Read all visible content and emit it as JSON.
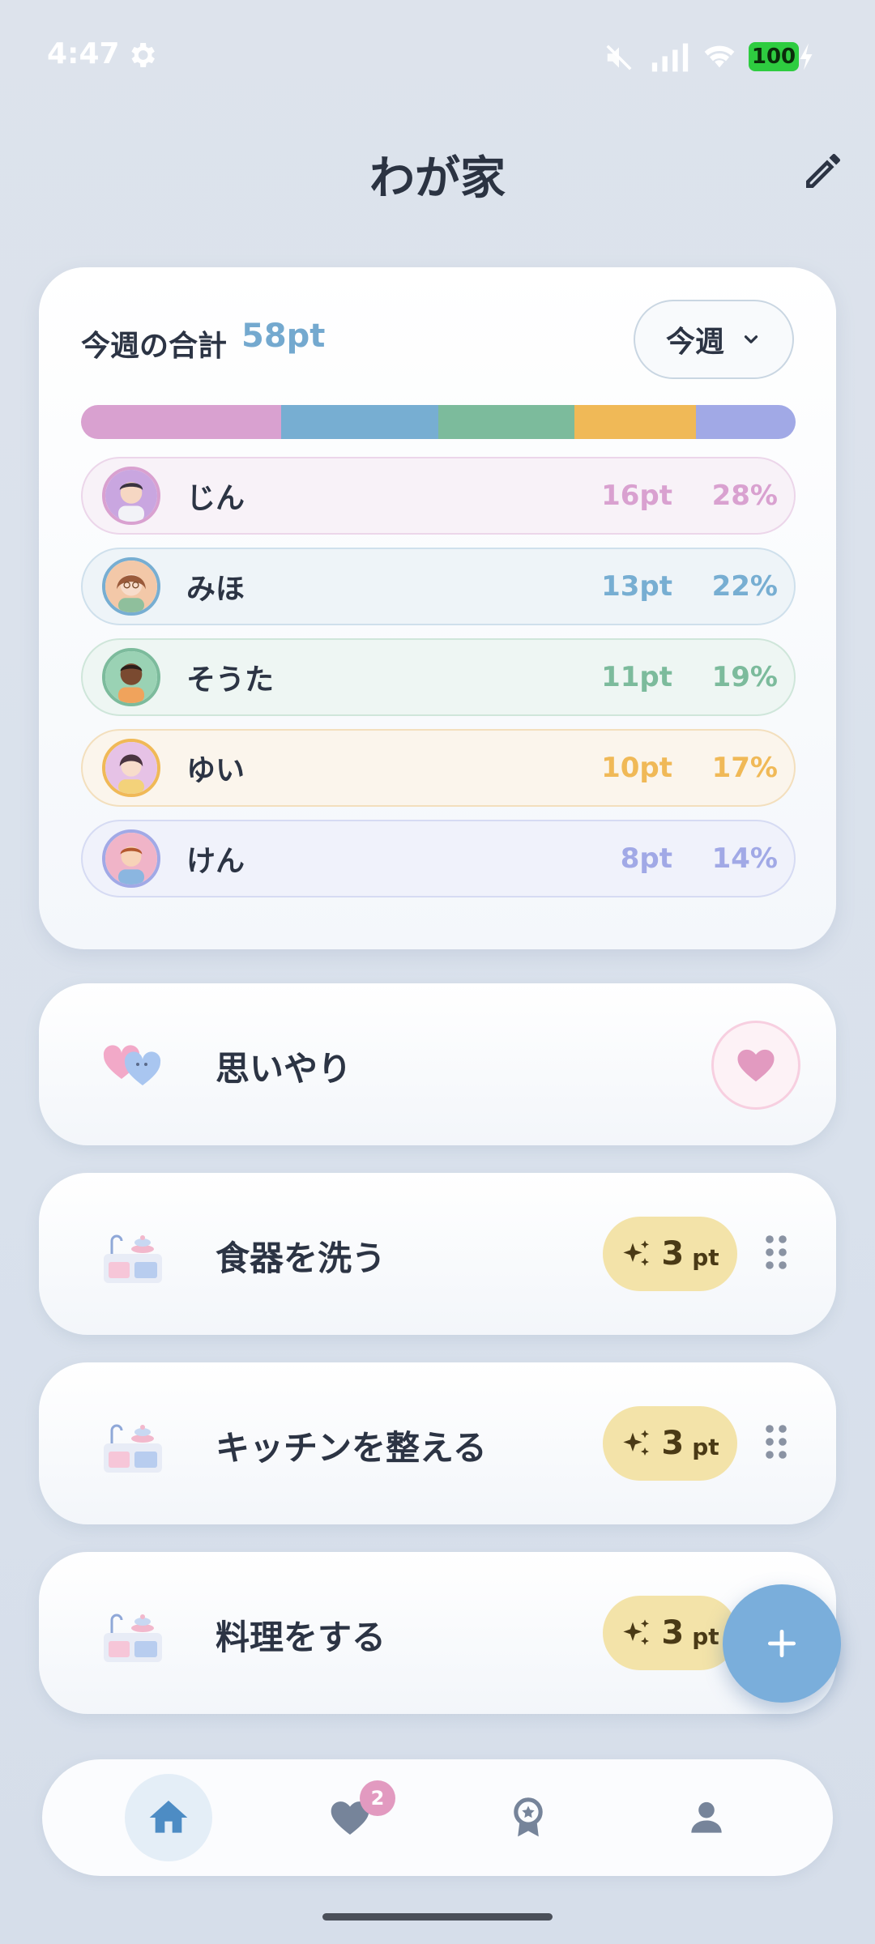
{
  "status_bar": {
    "time": "4:47",
    "battery": "100",
    "icons": [
      "gear-icon",
      "mute-icon",
      "signal-icon",
      "wifi-icon",
      "battery-icon",
      "charging-bolt-icon"
    ]
  },
  "header": {
    "title": "わが家",
    "edit_icon": "pencil-icon"
  },
  "summary": {
    "title": "今週の合計",
    "total": "58pt",
    "period_selected": "今週",
    "members": [
      {
        "name": "じん",
        "points": "16pt",
        "percent": "28%",
        "share": 0.28,
        "color": "#d9a1d0",
        "bg": "#f8f2f8",
        "border": "#ecd6ea"
      },
      {
        "name": "みほ",
        "points": "13pt",
        "percent": "22%",
        "share": 0.22,
        "color": "#77aed2",
        "bg": "#eef4f8",
        "border": "#cfe0ec"
      },
      {
        "name": "そうた",
        "points": "11pt",
        "percent": "19%",
        "share": 0.19,
        "color": "#7cbb9c",
        "bg": "#eef6f3",
        "border": "#cfe6da"
      },
      {
        "name": "ゆい",
        "points": "10pt",
        "percent": "17%",
        "share": 0.17,
        "color": "#f0b957",
        "bg": "#fbf5ec",
        "border": "#f3dfbd"
      },
      {
        "name": "けん",
        "points": "8pt",
        "percent": "14%",
        "share": 0.14,
        "color": "#a1a9e6",
        "bg": "#f0f2fb",
        "border": "#d6dbf3"
      }
    ]
  },
  "tasks": [
    {
      "label": "思いやり",
      "icon": "hearts-icon",
      "action": "heart-button"
    },
    {
      "label": "食器を洗う",
      "icon": "kitchen-icon",
      "points": "3",
      "unit": "pt"
    },
    {
      "label": "キッチンを整える",
      "icon": "kitchen-icon",
      "points": "3",
      "unit": "pt"
    },
    {
      "label": "料理をする",
      "icon": "kitchen-icon",
      "points": "3",
      "unit": "pt"
    }
  ],
  "fab": {
    "icon": "plus-icon"
  },
  "bottom_nav": {
    "items": [
      {
        "icon": "home-icon",
        "active": true
      },
      {
        "icon": "heart-icon",
        "badge": "2"
      },
      {
        "icon": "award-icon"
      },
      {
        "icon": "person-icon"
      }
    ]
  }
}
